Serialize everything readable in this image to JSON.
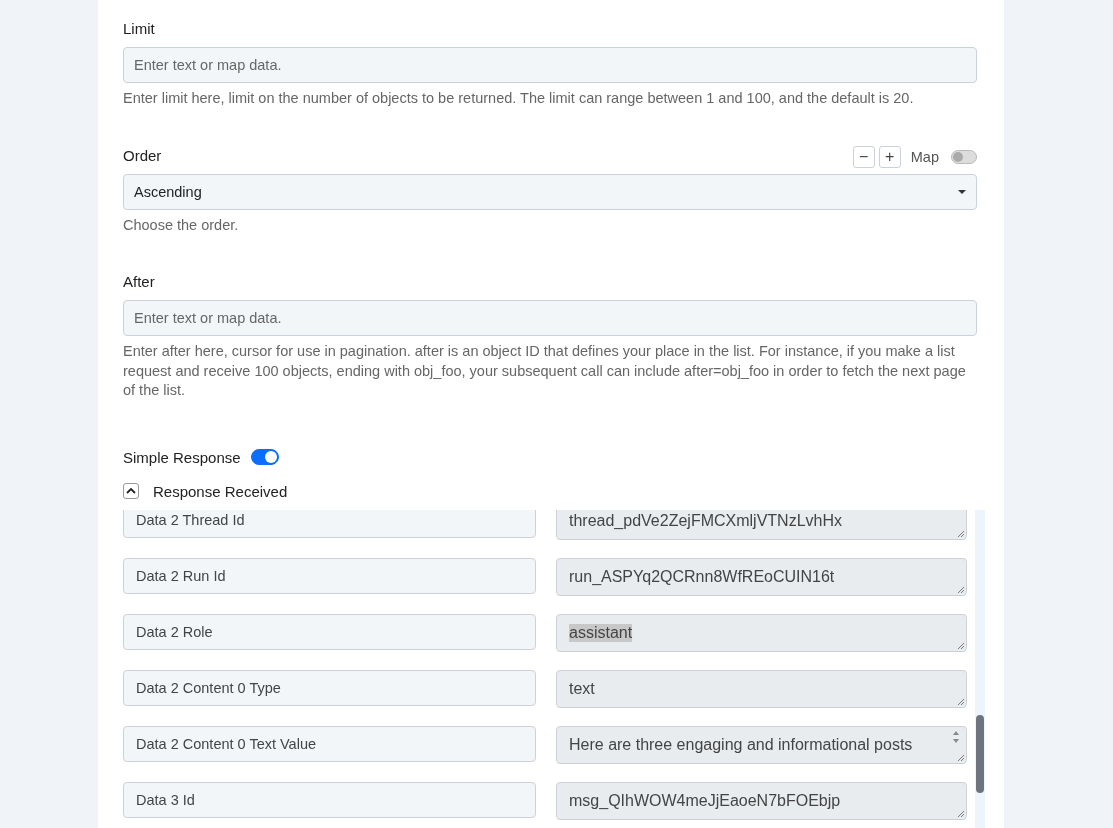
{
  "limit": {
    "label": "Limit",
    "placeholder": "Enter text or map data.",
    "help": "Enter limit here, limit on the number of objects to be returned. The limit can range between 1 and 100, and the default is 20."
  },
  "order": {
    "label": "Order",
    "minus": "−",
    "plus": "+",
    "map_label": "Map",
    "map_on": false,
    "value": "Ascending",
    "help": "Choose the order."
  },
  "after": {
    "label": "After",
    "placeholder": "Enter text or map data.",
    "help": "Enter after here, cursor for use in pagination. after is an object ID that defines your place in the list. For instance, if you make a list request and receive 100 objects, ending with obj_foo, your subsequent call can include after=obj_foo in order to fetch the next page of the list."
  },
  "simple_response": {
    "label": "Simple Response",
    "on": true
  },
  "response": {
    "label": "Response Received",
    "expanded": true,
    "rows": [
      {
        "name": "Data 2 Thread Id",
        "value": "thread_pdVe2ZejFMCXmljVTNzLvhHx",
        "highlighted": false,
        "spinner": false
      },
      {
        "name": "Data 2 Run Id",
        "value": "run_ASPYq2QCRnn8WfREoCUIN16t",
        "highlighted": false,
        "spinner": false
      },
      {
        "name": "Data 2 Role",
        "value": "assistant",
        "highlighted": true,
        "spinner": false
      },
      {
        "name": "Data 2 Content 0 Type",
        "value": "text",
        "highlighted": false,
        "spinner": false
      },
      {
        "name": "Data 2 Content 0 Text Value",
        "value": "Here are three engaging and informational posts",
        "highlighted": false,
        "spinner": true
      },
      {
        "name": "Data 3 Id",
        "value": "msg_QIhWOW4meJjEaoeN7bFOEbjp",
        "highlighted": false,
        "spinner": false
      }
    ]
  }
}
